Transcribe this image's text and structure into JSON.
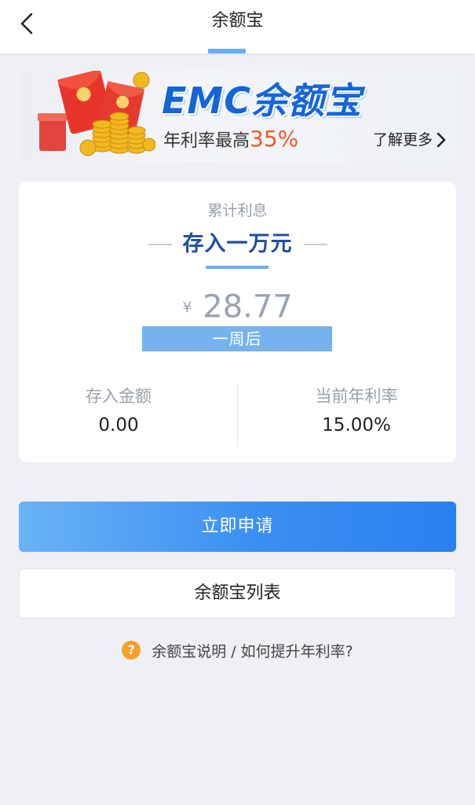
{
  "header": {
    "title": "余额宝"
  },
  "banner": {
    "logo_text": "EMC余额宝",
    "rate_prefix": "年利率最高",
    "rate_value": "35%",
    "more_label": "了解更多"
  },
  "card": {
    "subtitle": "累计利息",
    "title": "存入一万元",
    "currency": "¥",
    "amount": "28.77",
    "period": "一周后",
    "deposit_label": "存入金额",
    "deposit_value": "0.00",
    "rate_label": "当前年利率",
    "rate_value": "15.00%"
  },
  "actions": {
    "apply_label": "立即申请",
    "list_label": "余额宝列表"
  },
  "help": {
    "icon_glyph": "?",
    "text": "余额宝说明 / 如何提升年利率?"
  },
  "colors": {
    "accent": "#3a8ff2",
    "accent_light": "#76b3ee",
    "title_blue": "#1f4e9c",
    "highlight_orange": "#f0582a",
    "help_orange": "#f5a02a"
  }
}
